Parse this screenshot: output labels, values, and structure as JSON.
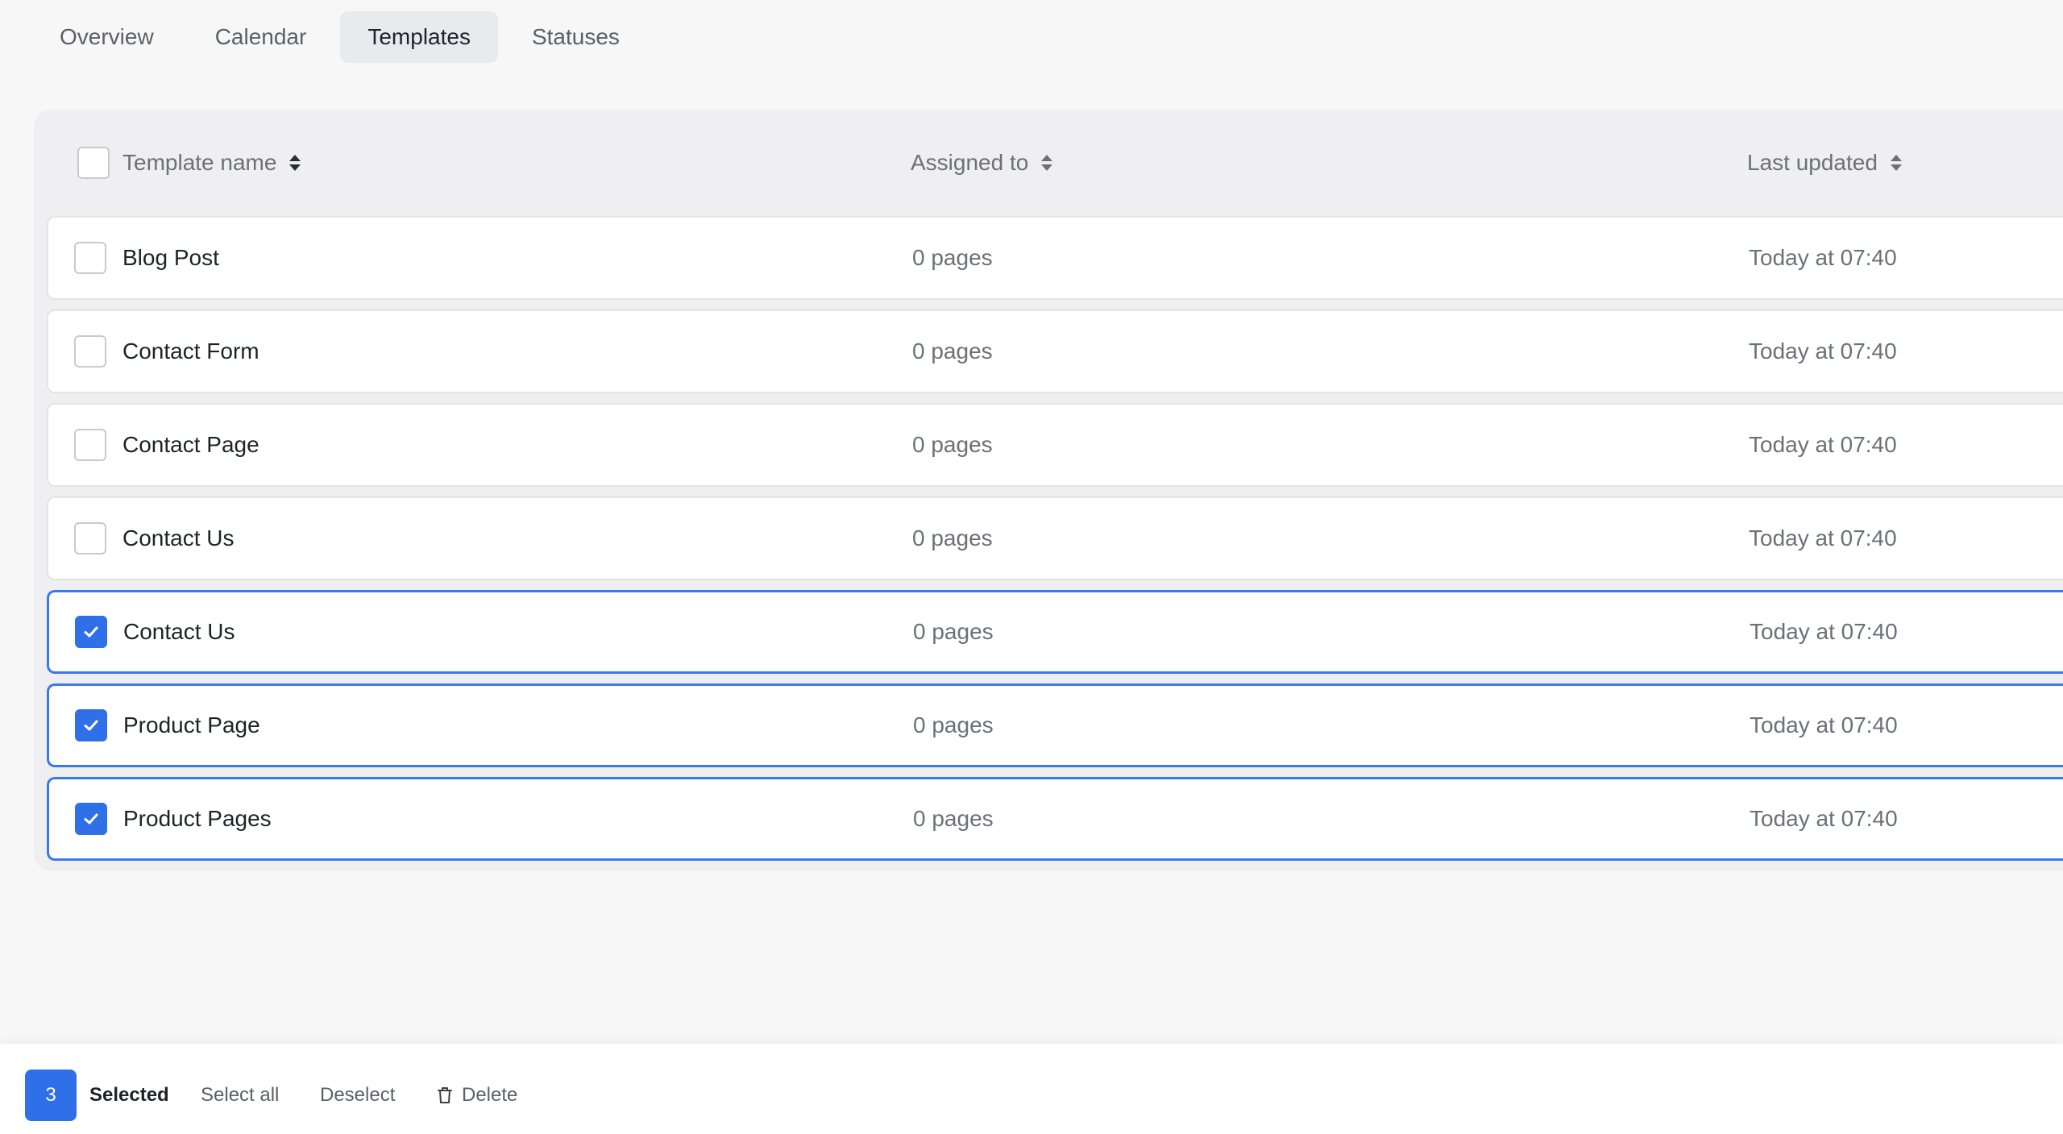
{
  "tabs": [
    {
      "label": "Overview",
      "active": false
    },
    {
      "label": "Calendar",
      "active": false
    },
    {
      "label": "Templates",
      "active": true
    },
    {
      "label": "Statuses",
      "active": false
    }
  ],
  "table": {
    "columns": {
      "name": "Template name",
      "assigned": "Assigned to",
      "updated": "Last updated"
    },
    "rows": [
      {
        "name": "Blog Post",
        "assigned": "0 pages",
        "updated": "Today at 07:40",
        "selected": false
      },
      {
        "name": "Contact Form",
        "assigned": "0 pages",
        "updated": "Today at 07:40",
        "selected": false
      },
      {
        "name": "Contact Page",
        "assigned": "0 pages",
        "updated": "Today at 07:40",
        "selected": false
      },
      {
        "name": "Contact Us",
        "assigned": "0 pages",
        "updated": "Today at 07:40",
        "selected": false
      },
      {
        "name": "Contact Us",
        "assigned": "0 pages",
        "updated": "Today at 07:40",
        "selected": true
      },
      {
        "name": "Product Page",
        "assigned": "0 pages",
        "updated": "Today at 07:40",
        "selected": true
      },
      {
        "name": "Product Pages",
        "assigned": "0 pages",
        "updated": "Today at 07:40",
        "selected": true
      }
    ]
  },
  "action_bar": {
    "count": "3",
    "selected_label": "Selected",
    "select_all": "Select all",
    "deselect": "Deselect",
    "delete": "Delete"
  },
  "colors": {
    "accent": "#2f6fe8",
    "selected_border": "#3a78ee",
    "background": "#f7f7f8",
    "table_bg": "#efeff2"
  },
  "icons": {
    "sort": "sort-icon",
    "check": "check-icon",
    "delete": "trash-icon"
  }
}
